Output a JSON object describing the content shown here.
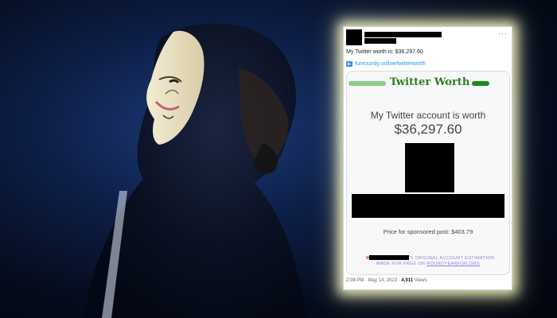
{
  "tweet": {
    "more_label": "···",
    "text": "My Twitter worth is: $36,297.60",
    "link_text": "funroundy.online/twitterworth",
    "meta_time": "2:08 PM · May 14, 2023 ·",
    "meta_views_count": "4,911",
    "meta_views_label": "Views"
  },
  "embed": {
    "brand_title": "Twitter Worth",
    "worth_label": "My Twitter account is worth",
    "worth_value": "$36,297.60",
    "price_label": "Price for sponsored post: $403.79",
    "footer_line1": "'S ORIGINAL ACCOUNT ESTIMATION",
    "footer_line2_prefix": "MADE FOR FREE ON",
    "footer_line2_link": "ROUNDYEARFUN.ORG"
  },
  "colors": {
    "brand_green": "#2f7d24",
    "link_blue": "#1d9bf0",
    "glow": "#ffffc8"
  }
}
